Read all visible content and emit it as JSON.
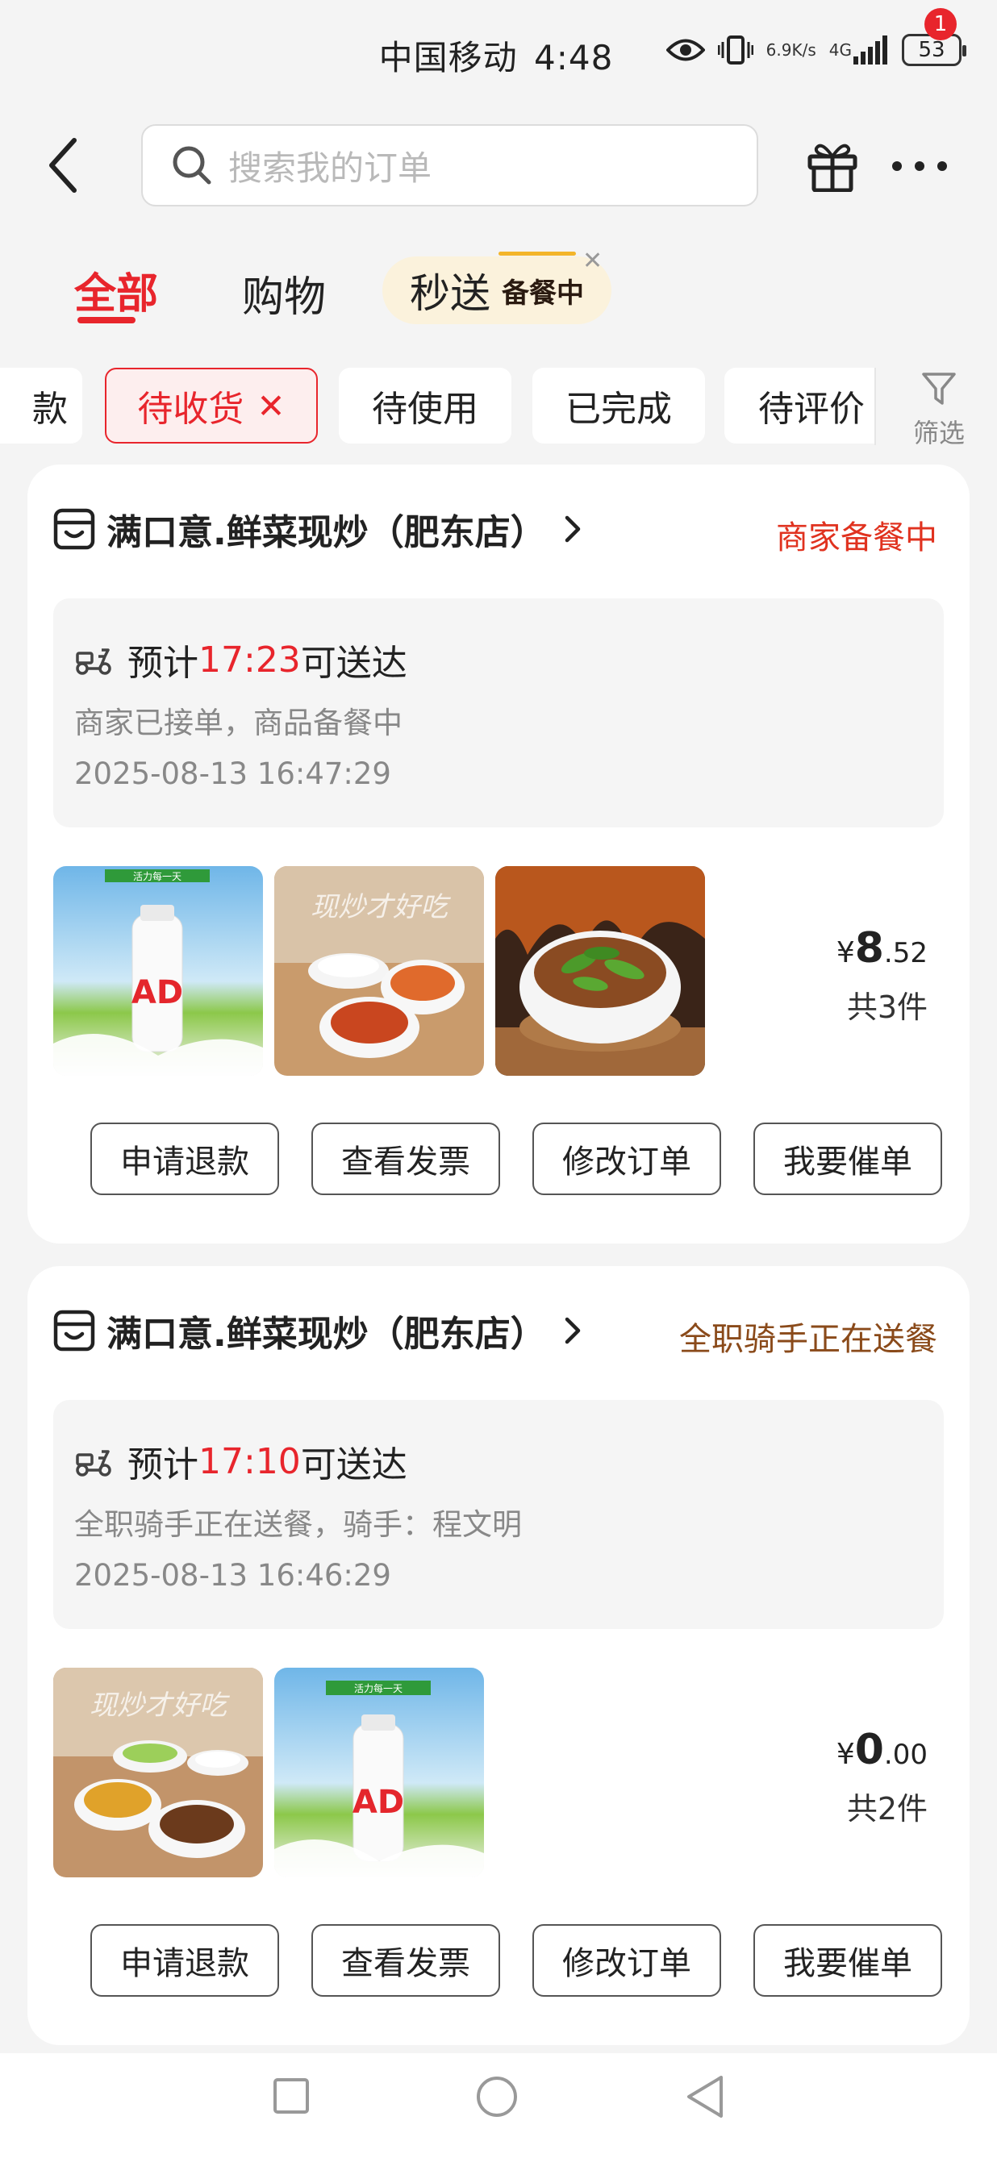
{
  "status_bar": {
    "carrier": "中国移动",
    "time": "4:48",
    "speed_top": "6.9",
    "speed_bottom": "K/s",
    "network": "4G",
    "battery": "53"
  },
  "header": {
    "search_placeholder": "搜索我的订单",
    "notification_count": "1"
  },
  "tabs": {
    "all": "全部",
    "shopping": "购物",
    "miaosong": "秒送",
    "miaosong_badge": "备餐中"
  },
  "chips": {
    "partial": "款",
    "active": "待收货",
    "to_use": "待使用",
    "completed": "已完成",
    "to_review": "待评价",
    "filter": "筛选"
  },
  "orders": [
    {
      "shop": "满口意.鲜菜现炒（肥东店）",
      "status": "商家备餐中",
      "status_color": "#e0321f",
      "eta_prefix": "预计",
      "eta_time": "17:23",
      "eta_suffix": "可送达",
      "detail": "商家已接单，商品备餐中",
      "timestamp": "2025-08-13 16:47:29",
      "price_symbol": "¥",
      "price_int": "8",
      "price_dec": ".52",
      "count": "共3件",
      "thumb_banner": "活力每一天",
      "thumb_caption": "现炒才好吃",
      "buttons": [
        "申请退款",
        "查看发票",
        "修改订单",
        "我要催单"
      ]
    },
    {
      "shop": "满口意.鲜菜现炒（肥东店）",
      "status": "全职骑手正在送餐",
      "status_color": "#8a4a1a",
      "eta_prefix": "预计",
      "eta_time": "17:10",
      "eta_suffix": "可送达",
      "detail": "全职骑手正在送餐，骑手：程文明",
      "timestamp": "2025-08-13 16:46:29",
      "price_symbol": "¥",
      "price_int": "0",
      "price_dec": ".00",
      "count": "共2件",
      "thumb_banner": "活力每一天",
      "thumb_caption": "现炒才好吃",
      "buttons": [
        "申请退款",
        "查看发票",
        "修改订单",
        "我要催单"
      ]
    }
  ],
  "colors": {
    "accent": "#e8252c",
    "background": "#f4f4f4"
  }
}
